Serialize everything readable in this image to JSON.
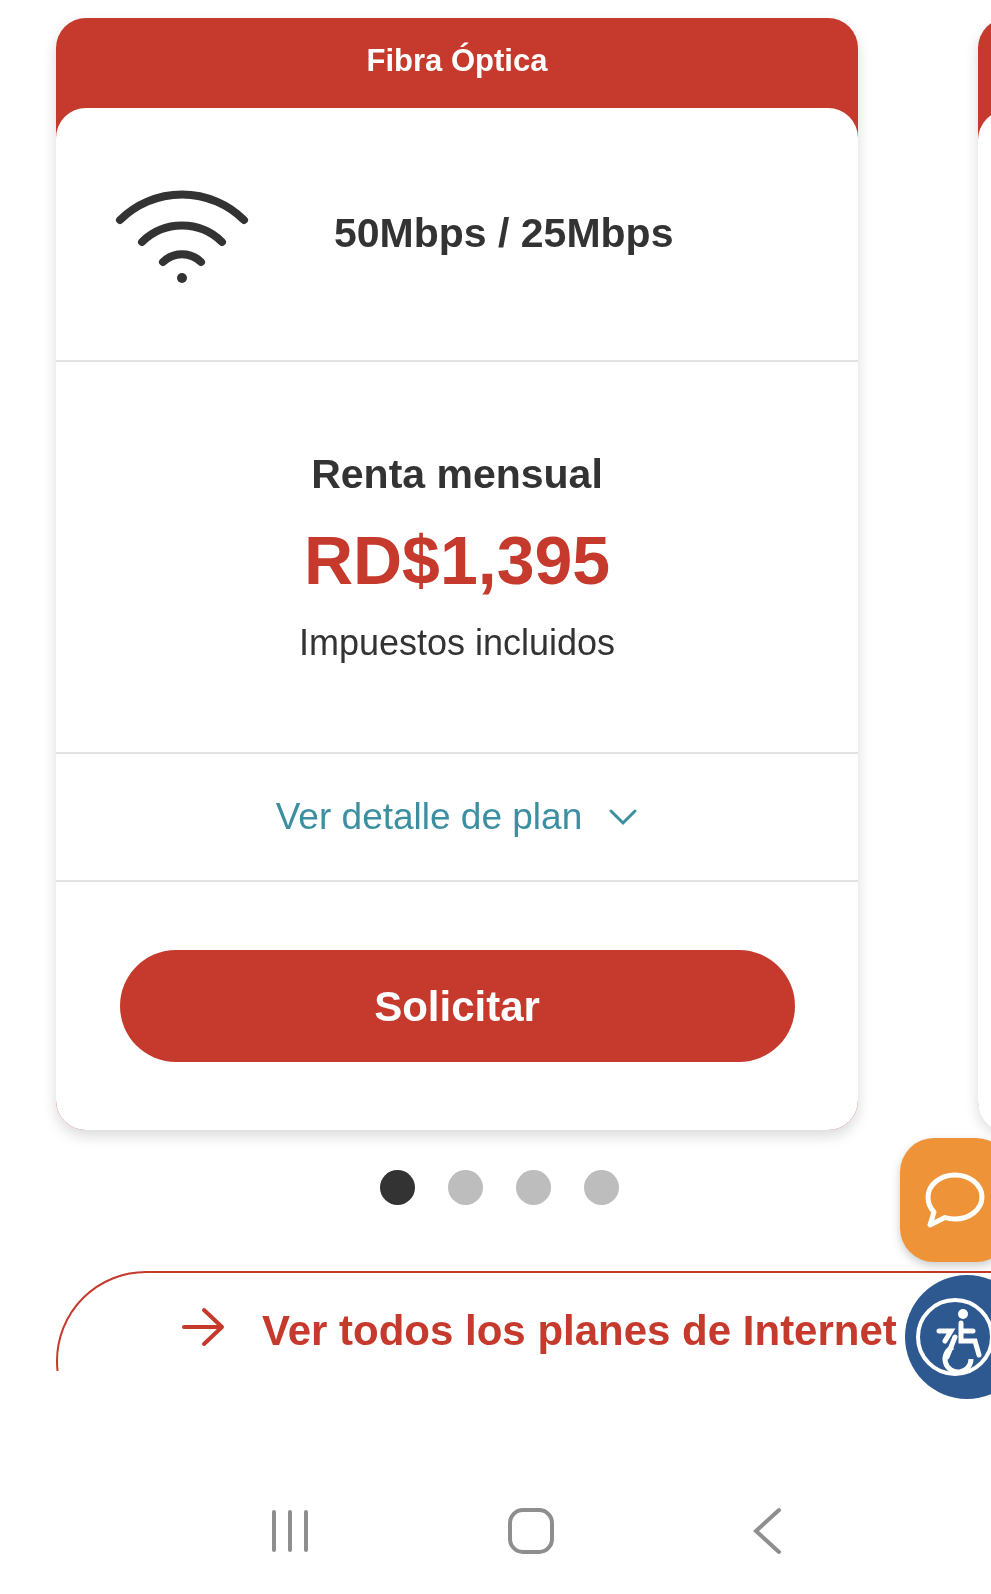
{
  "plan": {
    "header": "Fibra Óptica",
    "speed": "50Mbps / 25Mbps",
    "price_label": "Renta mensual",
    "price": "RD$1,395",
    "tax_note": "Impuestos incluidos",
    "details_link": "Ver detalle de plan",
    "expanded": false,
    "cta": "Solicitar"
  },
  "carousel_dots": [
    {
      "selected": true
    },
    {
      "selected": false
    },
    {
      "selected": false
    },
    {
      "selected": false
    }
  ],
  "all_plans_link": "Ver todos los planes de Internet"
}
